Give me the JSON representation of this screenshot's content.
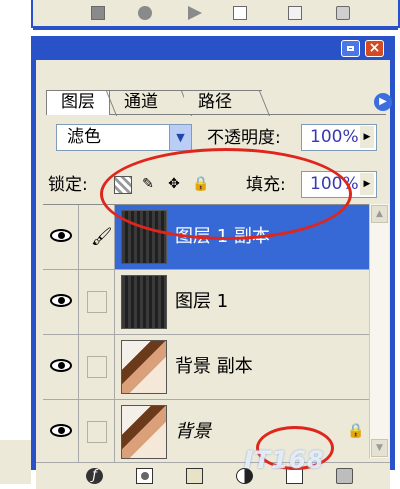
{
  "actions_toolbar": {
    "buttons": [
      "stop-icon",
      "record-icon",
      "play-icon",
      "new-set-icon",
      "new-action-icon",
      "trash-icon"
    ]
  },
  "palette": {
    "tabs": [
      {
        "label": "图层",
        "active": true
      },
      {
        "label": "通道",
        "active": false
      },
      {
        "label": "路径",
        "active": false
      }
    ],
    "close_label": "×",
    "menu_label": "▶",
    "blend_mode": "滤色",
    "opacity_label": "不透明度:",
    "opacity_value": "100%",
    "lock_label": "锁定:",
    "fill_label": "填充:",
    "fill_value": "100%",
    "layers": [
      {
        "name": "图层 1 副本",
        "selected": true,
        "visible": true,
        "linked_brush": true,
        "thumb": "dark-stripes"
      },
      {
        "name": "图层 1",
        "selected": false,
        "visible": true,
        "linked_brush": false,
        "thumb": "dark-stripes"
      },
      {
        "name": "背景 副本",
        "selected": false,
        "visible": true,
        "linked_brush": false,
        "thumb": "photo"
      },
      {
        "name": "背景",
        "selected": false,
        "visible": true,
        "linked_brush": false,
        "thumb": "photo",
        "locked": true
      }
    ],
    "bottom_icons": [
      "layer-style-icon",
      "mask-icon",
      "new-group-icon",
      "adjustment-layer-icon",
      "new-layer-icon",
      "trash-icon"
    ]
  },
  "watermark": "IT168"
}
